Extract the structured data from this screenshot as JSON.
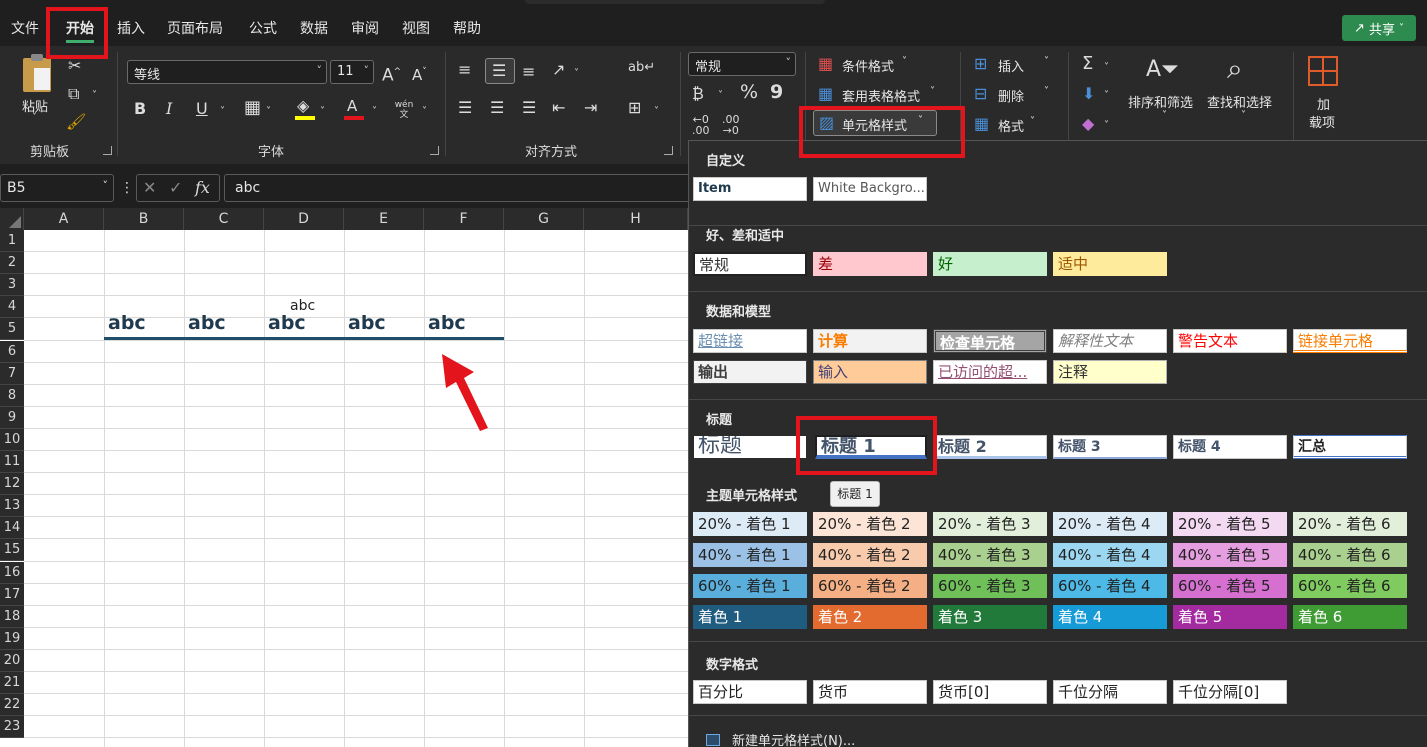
{
  "ribbon_tabs": [
    "文件",
    "开始",
    "插入",
    "页面布局",
    "公式",
    "数据",
    "审阅",
    "视图",
    "帮助"
  ],
  "share_label": "共享",
  "clipboard": {
    "paste": "粘贴",
    "group": "剪贴板"
  },
  "font": {
    "name": "等线",
    "size": "11",
    "group": "字体",
    "grow": "A^",
    "shrink": "A˅",
    "bold": "B",
    "italic": "I",
    "underline": "U",
    "phonetic": "wén 文"
  },
  "alignment": {
    "group": "对齐方式"
  },
  "number": {
    "format": "常规",
    "percent": "%",
    "comma": "9"
  },
  "styles": {
    "conditional": "条件格式",
    "table": "套用表格格式",
    "cell_styles": "单元格样式"
  },
  "cells": {
    "insert": "插入",
    "delete": "删除",
    "format": "格式"
  },
  "editing": {
    "sort": "排序和筛选",
    "find": "查找和选择"
  },
  "addins": {
    "label_line1": "加",
    "label_line2": "载项"
  },
  "formula_bar": {
    "name_box": "B5",
    "formula": "abc",
    "fx": "fx"
  },
  "columns": [
    "A",
    "B",
    "C",
    "D",
    "E",
    "F",
    "G",
    "H"
  ],
  "rows": [
    "1",
    "2",
    "3",
    "4",
    "5",
    "6",
    "7",
    "8",
    "9",
    "10",
    "11",
    "12",
    "13",
    "14",
    "15",
    "16",
    "17",
    "18",
    "19",
    "20",
    "21",
    "22",
    "23"
  ],
  "cells_content": {
    "d4": "abc",
    "row5": [
      "abc",
      "abc",
      "abc",
      "abc",
      "abc"
    ]
  },
  "gallery": {
    "custom_title": "自定义",
    "custom": [
      "Item",
      "White Backgro..."
    ],
    "good_bad_title": "好、差和适中",
    "good_bad": [
      "常规",
      "差",
      "好",
      "适中"
    ],
    "data_model_title": "数据和模型",
    "data_model_row1": [
      "超链接",
      "计算",
      "检查单元格",
      "解释性文本",
      "警告文本",
      "链接单元格"
    ],
    "data_model_row2": [
      "输出",
      "输入",
      "已访问的超...",
      "注释"
    ],
    "titles_title": "标题",
    "titles": [
      "标题",
      "标题 1",
      "标题 2",
      "标题 3",
      "标题 4",
      "汇总"
    ],
    "theme_title": "主题单元格样式",
    "theme_rows": [
      [
        "20% - 着色 1",
        "20% - 着色 2",
        "20% - 着色 3",
        "20% - 着色 4",
        "20% - 着色 5",
        "20% - 着色 6"
      ],
      [
        "40% - 着色 1",
        "40% - 着色 2",
        "40% - 着色 3",
        "40% - 着色 4",
        "40% - 着色 5",
        "40% - 着色 6"
      ],
      [
        "60% - 着色 1",
        "60% - 着色 2",
        "60% - 着色 3",
        "60% - 着色 4",
        "60% - 着色 5",
        "60% - 着色 6"
      ],
      [
        "着色 1",
        "着色 2",
        "着色 3",
        "着色 4",
        "着色 5",
        "着色 6"
      ]
    ],
    "number_title": "数字格式",
    "number_styles": [
      "百分比",
      "货币",
      "货币[0]",
      "千位分隔",
      "千位分隔[0]"
    ],
    "new_style": "新建单元格样式(N)...",
    "tooltip": "标题 1"
  },
  "colors": {
    "accent_tab": "#3fae6c",
    "highlight": "#e3141c",
    "theme20": [
      "#ddebf7",
      "#fce4d6",
      "#e2efda",
      "#ddebf7",
      "#f4d9f2",
      "#e2efda"
    ],
    "theme40": [
      "#9bc2e6",
      "#f8cbad",
      "#a9d08e",
      "#9bd7f1",
      "#e59ee0",
      "#a9d08e"
    ],
    "theme60": [
      "#5aaedc",
      "#f4b084",
      "#70c05a",
      "#4cb9e7",
      "#d670d0",
      "#7fcb5f"
    ],
    "theme100": [
      "#1f5c80",
      "#e46b2f",
      "#217a3a",
      "#179bd7",
      "#a42aa0",
      "#3f9c35"
    ]
  }
}
